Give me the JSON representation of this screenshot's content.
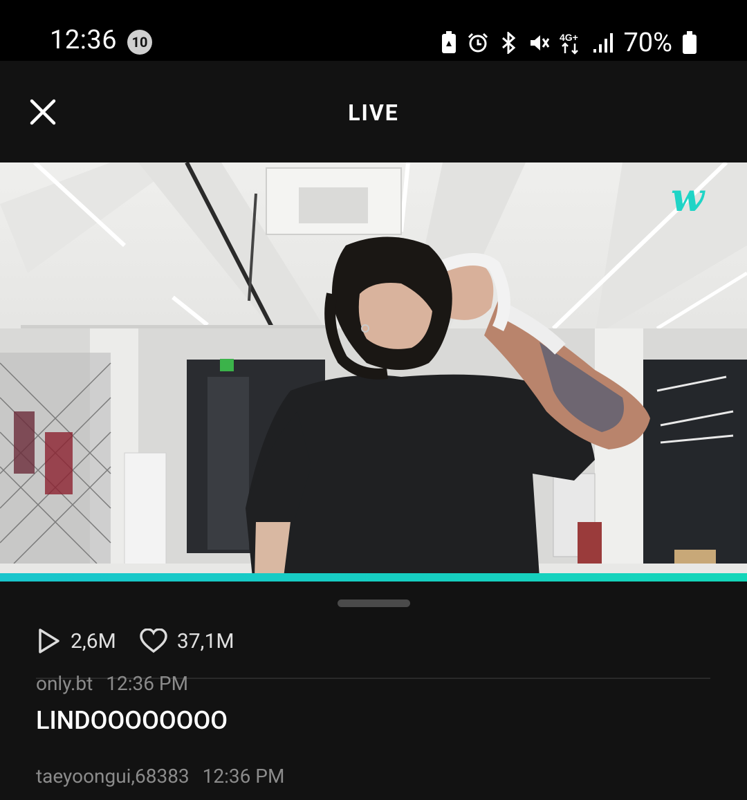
{
  "status_bar": {
    "time": "12:36",
    "notification_count": "10",
    "battery_percent": "70%",
    "network": "4G+"
  },
  "header": {
    "title": "LIVE"
  },
  "stats": {
    "plays": "2,6M",
    "likes": "37,1M"
  },
  "comments": [
    {
      "user": "only.bt",
      "time": "12:36 PM",
      "text": "LINDOOOOOOOO"
    },
    {
      "user": "taeyoongui,68383",
      "time": "12:36 PM",
      "text": ""
    }
  ],
  "video": {
    "progress_percent": 100,
    "watermark": "w",
    "accent": "#19c5cc"
  }
}
